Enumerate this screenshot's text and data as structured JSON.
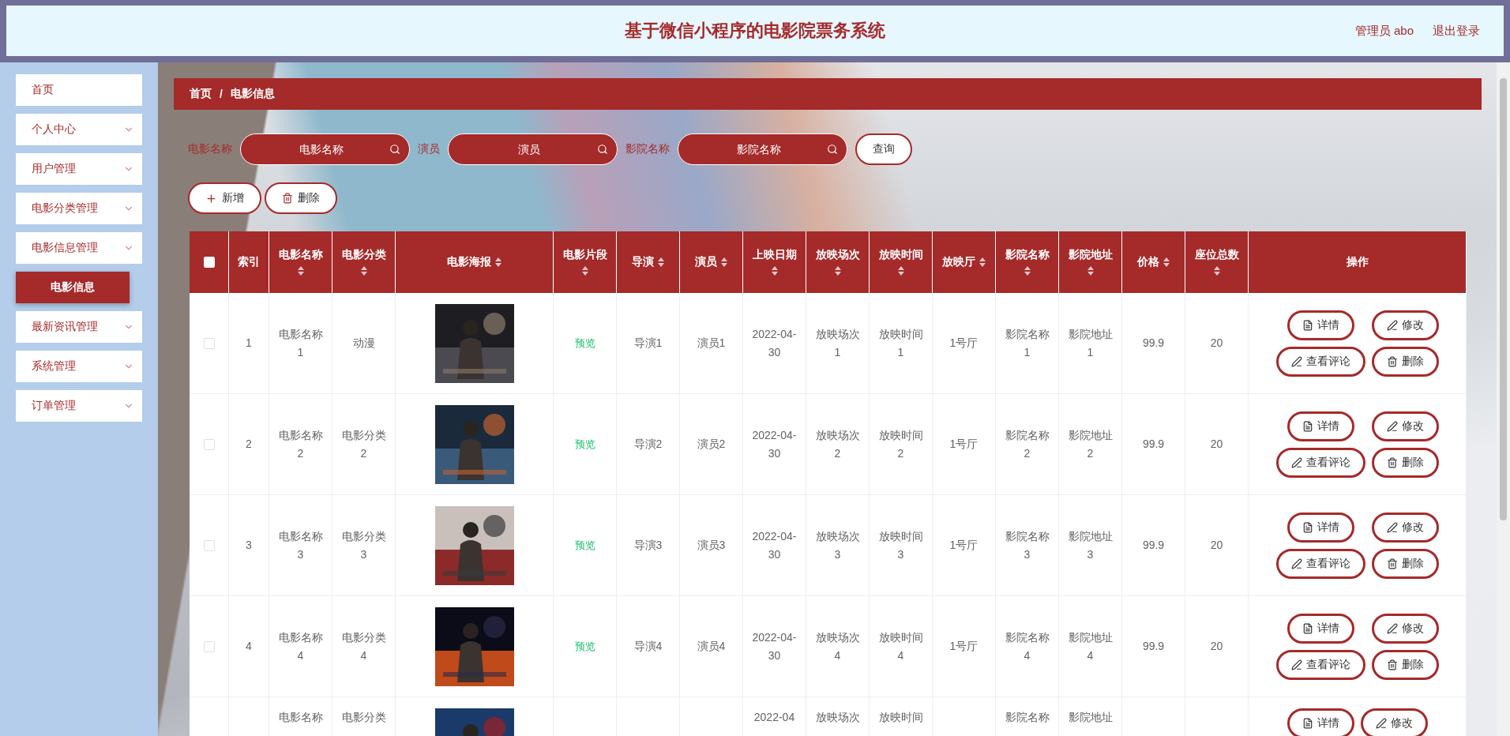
{
  "header": {
    "title": "基于微信小程序的电影院票务系统",
    "user": "管理员 abo",
    "logout": "退出登录"
  },
  "sidebar": {
    "items": [
      {
        "label": "首页",
        "kind": "link"
      },
      {
        "label": "个人中心",
        "kind": "menu"
      },
      {
        "label": "用户管理",
        "kind": "menu"
      },
      {
        "label": "电影分类管理",
        "kind": "menu"
      },
      {
        "label": "电影信息管理",
        "kind": "menu",
        "children": [
          {
            "label": "电影信息",
            "selected": true
          }
        ]
      },
      {
        "label": "最新资讯管理",
        "kind": "menu"
      },
      {
        "label": "系统管理",
        "kind": "menu"
      },
      {
        "label": "订单管理",
        "kind": "menu"
      }
    ]
  },
  "breadcrumb": {
    "items": [
      "首页",
      "电影信息"
    ],
    "separator": "/"
  },
  "search": {
    "fields": [
      {
        "label": "电影名称",
        "placeholder": "电影名称"
      },
      {
        "label": "演员",
        "placeholder": "演员"
      },
      {
        "label": "影院名称",
        "placeholder": "影院名称"
      }
    ],
    "button": "查询"
  },
  "actions": [
    {
      "label": "新增",
      "kind": "add"
    },
    {
      "label": "删除",
      "kind": "delete"
    }
  ],
  "table": {
    "select_all": {
      "checked": false
    },
    "columns": [
      {
        "label": "索引",
        "sortable": false
      },
      {
        "label": "电影名称",
        "sortable": true
      },
      {
        "label": "电影分类",
        "sortable": true
      },
      {
        "label": "电影海报",
        "sortable": true
      },
      {
        "label": "电影片段",
        "sortable": true
      },
      {
        "label": "导演",
        "sortable": true
      },
      {
        "label": "演员",
        "sortable": true
      },
      {
        "label": "上映日期",
        "sortable": true
      },
      {
        "label": "放映场次",
        "sortable": true
      },
      {
        "label": "放映时间",
        "sortable": true
      },
      {
        "label": "放映厅",
        "sortable": true
      },
      {
        "label": "影院名称",
        "sortable": true
      },
      {
        "label": "影院地址",
        "sortable": true
      },
      {
        "label": "价格",
        "sortable": true
      },
      {
        "label": "座位总数",
        "sortable": true
      },
      {
        "label": "操作",
        "sortable": false
      }
    ],
    "rows": [
      {
        "checked": false,
        "cells": [
          {
            "kind": "text",
            "text": "1"
          },
          {
            "kind": "text",
            "text": "电影名称1"
          },
          {
            "kind": "text",
            "text": "动漫"
          },
          {
            "kind": "picture"
          },
          {
            "kind": "link",
            "text": "预览"
          },
          {
            "kind": "text",
            "text": "导演1"
          },
          {
            "kind": "text",
            "text": "演员1"
          },
          {
            "kind": "text",
            "text": "2022-04-30"
          },
          {
            "kind": "text",
            "text": "放映场次1"
          },
          {
            "kind": "text",
            "text": "放映时间1"
          },
          {
            "kind": "text",
            "text": "1号厅"
          },
          {
            "kind": "text",
            "text": "影院名称1"
          },
          {
            "kind": "text",
            "text": "影院地址1"
          },
          {
            "kind": "text",
            "text": "99.9"
          },
          {
            "kind": "text",
            "text": "20"
          },
          {
            "kind": "actions",
            "buttons": [
              {
                "label": "详情",
                "kind": "detail"
              },
              {
                "label": "修改",
                "kind": "edit"
              },
              {
                "label": "查看评论",
                "kind": "comments"
              },
              {
                "label": "删除",
                "kind": "delete"
              }
            ]
          }
        ]
      },
      {
        "checked": false,
        "cells": [
          {
            "kind": "text",
            "text": "2"
          },
          {
            "kind": "text",
            "text": "电影名称2"
          },
          {
            "kind": "text",
            "text": "电影分类2"
          },
          {
            "kind": "picture"
          },
          {
            "kind": "link",
            "text": "预览"
          },
          {
            "kind": "text",
            "text": "导演2"
          },
          {
            "kind": "text",
            "text": "演员2"
          },
          {
            "kind": "text",
            "text": "2022-04-30"
          },
          {
            "kind": "text",
            "text": "放映场次2"
          },
          {
            "kind": "text",
            "text": "放映时间2"
          },
          {
            "kind": "text",
            "text": "1号厅"
          },
          {
            "kind": "text",
            "text": "影院名称2"
          },
          {
            "kind": "text",
            "text": "影院地址2"
          },
          {
            "kind": "text",
            "text": "99.9"
          },
          {
            "kind": "text",
            "text": "20"
          },
          {
            "kind": "actions",
            "buttons": [
              {
                "label": "详情",
                "kind": "detail"
              },
              {
                "label": "修改",
                "kind": "edit"
              },
              {
                "label": "查看评论",
                "kind": "comments"
              },
              {
                "label": "删除",
                "kind": "delete"
              }
            ]
          }
        ]
      },
      {
        "checked": false,
        "cells": [
          {
            "kind": "text",
            "text": "3"
          },
          {
            "kind": "text",
            "text": "电影名称3"
          },
          {
            "kind": "text",
            "text": "电影分类3"
          },
          {
            "kind": "picture"
          },
          {
            "kind": "link",
            "text": "预览"
          },
          {
            "kind": "text",
            "text": "导演3"
          },
          {
            "kind": "text",
            "text": "演员3"
          },
          {
            "kind": "text",
            "text": "2022-04-30"
          },
          {
            "kind": "text",
            "text": "放映场次3"
          },
          {
            "kind": "text",
            "text": "放映时间3"
          },
          {
            "kind": "text",
            "text": "1号厅"
          },
          {
            "kind": "text",
            "text": "影院名称3"
          },
          {
            "kind": "text",
            "text": "影院地址3"
          },
          {
            "kind": "text",
            "text": "99.9"
          },
          {
            "kind": "text",
            "text": "20"
          },
          {
            "kind": "actions",
            "buttons": [
              {
                "label": "详情",
                "kind": "detail"
              },
              {
                "label": "修改",
                "kind": "edit"
              },
              {
                "label": "查看评论",
                "kind": "comments"
              },
              {
                "label": "删除",
                "kind": "delete"
              }
            ]
          }
        ]
      },
      {
        "checked": false,
        "cells": [
          {
            "kind": "text",
            "text": "4"
          },
          {
            "kind": "text",
            "text": "电影名称4"
          },
          {
            "kind": "text",
            "text": "电影分类4"
          },
          {
            "kind": "picture"
          },
          {
            "kind": "link",
            "text": "预览"
          },
          {
            "kind": "text",
            "text": "导演4"
          },
          {
            "kind": "text",
            "text": "演员4"
          },
          {
            "kind": "text",
            "text": "2022-04-30"
          },
          {
            "kind": "text",
            "text": "放映场次4"
          },
          {
            "kind": "text",
            "text": "放映时间4"
          },
          {
            "kind": "text",
            "text": "1号厅"
          },
          {
            "kind": "text",
            "text": "影院名称4"
          },
          {
            "kind": "text",
            "text": "影院地址4"
          },
          {
            "kind": "text",
            "text": "99.9"
          },
          {
            "kind": "text",
            "text": "20"
          },
          {
            "kind": "actions",
            "buttons": [
              {
                "label": "详情",
                "kind": "detail"
              },
              {
                "label": "修改",
                "kind": "edit"
              },
              {
                "label": "查看评论",
                "kind": "comments"
              },
              {
                "label": "删除",
                "kind": "delete"
              }
            ]
          }
        ]
      },
      {
        "cells": [
          {
            "kind": "text"
          },
          {
            "kind": "text",
            "text": "电影名称"
          },
          {
            "kind": "text",
            "text": "电影分类"
          },
          {
            "kind": "picture"
          },
          {
            "kind": "text"
          },
          {
            "kind": "text"
          },
          {
            "kind": "text"
          },
          {
            "kind": "text",
            "text": "2022-04"
          },
          {
            "kind": "text",
            "text": "放映场次"
          },
          {
            "kind": "text",
            "text": "放映时间"
          },
          {
            "kind": "text"
          },
          {
            "kind": "text",
            "text": "影院名称"
          },
          {
            "kind": "text",
            "text": "影院地址"
          },
          {
            "kind": "text"
          },
          {
            "kind": "text"
          },
          {
            "kind": "actions",
            "buttons": [
              {
                "label": "详情",
                "kind": "detail"
              },
              {
                "label": "修改",
                "kind": "edit"
              }
            ]
          }
        ]
      }
    ]
  }
}
